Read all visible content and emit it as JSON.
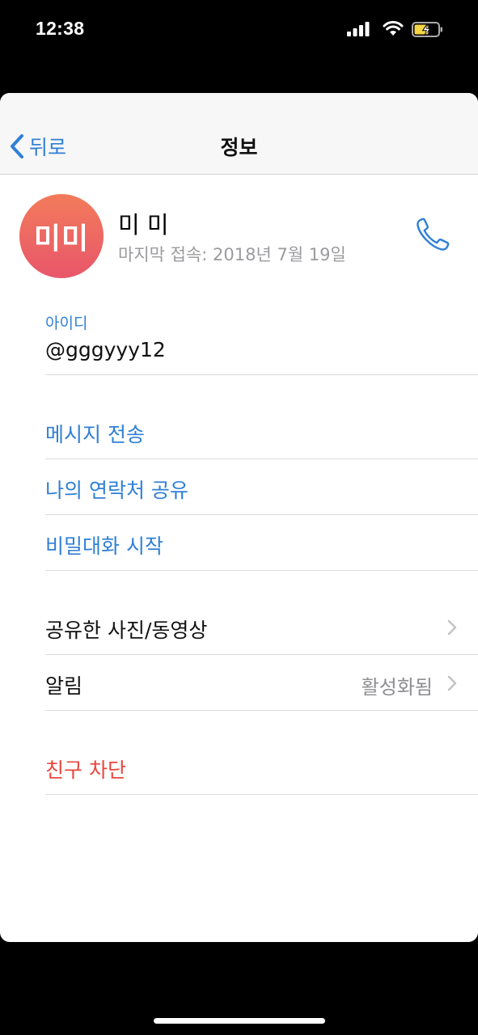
{
  "status_bar": {
    "time": "12:38",
    "icons": [
      "signal-icon",
      "wifi-icon",
      "battery-charging-icon"
    ]
  },
  "nav": {
    "back_label": "뒤로",
    "title": "정보"
  },
  "profile": {
    "avatar_initials": "미미",
    "name": "미 미",
    "last_seen": "마지막 접속: 2018년 7월 19일",
    "call_icon": "phone-icon"
  },
  "id_field": {
    "label": "아이디",
    "value": "@gggyyy12"
  },
  "actions": [
    {
      "label": "메시지 전송"
    },
    {
      "label": "나의 연락처 공유"
    },
    {
      "label": "비밀대화 시작"
    }
  ],
  "settings": [
    {
      "label": "공유한 사진/동영상",
      "value": ""
    },
    {
      "label": "알림",
      "value": "활성화됨"
    }
  ],
  "danger": {
    "block_label": "친구 차단"
  },
  "colors": {
    "accent": "#2f7fd6",
    "danger": "#e8453c",
    "avatar_top": "#f27b5b",
    "avatar_bottom": "#e8566a"
  }
}
